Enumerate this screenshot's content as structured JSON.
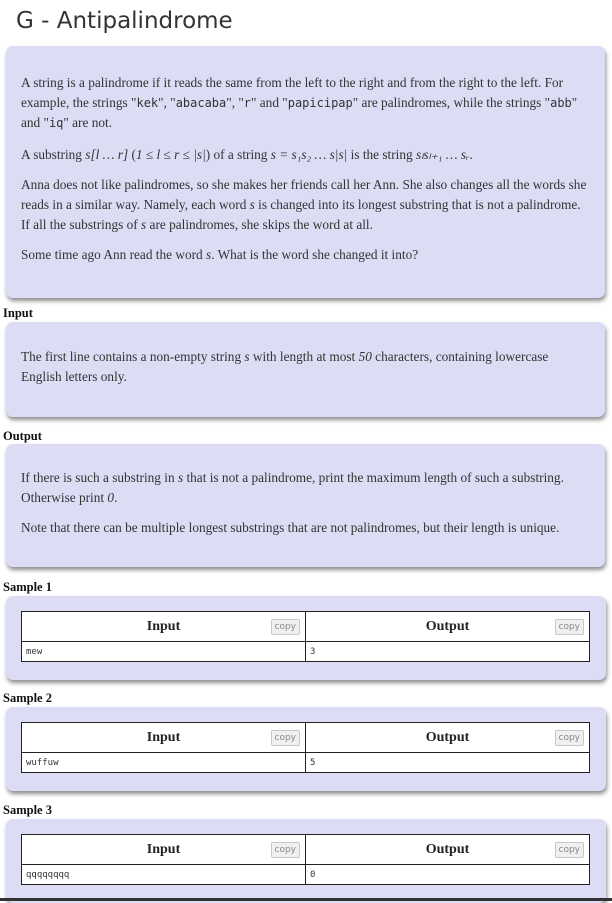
{
  "title": "G - Antipalindrome",
  "statement": {
    "p1_a": "A string is a palindrome if it reads the same from the left to the right and from the right to the left. For example, the strings \"",
    "ex1": "kek",
    "sep1": "\", \"",
    "ex2": "abacaba",
    "sep2": "\", \"",
    "ex3": "r",
    "sep3": "\" and \"",
    "ex4": "papicipap",
    "sep4": "\" are palindromes, while the strings \"",
    "ex5": "abb",
    "sep5": "\" and \"",
    "ex6": "iq",
    "p1_end": "\" are not.",
    "p2_a": "A substring ",
    "p2_m1": "s[l … r]",
    "p2_b": " (",
    "p2_m2": "1 ≤ l ≤ r ≤ |s|",
    "p2_c": ") of a string ",
    "p2_m3": "s = s₁s₂ … s|s|",
    "p2_d": " is the string ",
    "p2_m4": "sₗsₗ₊₁ … sᵣ",
    "p2_e": ".",
    "p3_a": "Anna does not like palindromes, so she makes her friends call her Ann. She also changes all the words she reads in a similar way. Namely, each word ",
    "p3_m1": "s",
    "p3_b": " is changed into its longest substring that is not a palindrome. If all the substrings of ",
    "p3_m2": "s",
    "p3_c": " are palindromes, she skips the word at all.",
    "p4_a": "Some time ago Ann read the word ",
    "p4_m": "s",
    "p4_b": ". What is the word she changed it into?"
  },
  "input_section": {
    "heading": "Input",
    "text_a": "The first line contains a non-empty string ",
    "text_m1": "s",
    "text_b": " with length at most ",
    "text_m2": "50",
    "text_c": " characters, containing lowercase English letters only."
  },
  "output_section": {
    "heading": "Output",
    "p1_a": "If there is such a substring in ",
    "p1_m1": "s",
    "p1_b": " that is not a palindrome, print the maximum length of such a substring. Otherwise print ",
    "p1_m2": "0",
    "p1_c": ".",
    "p2": "Note that there can be multiple longest substrings that are not palindromes, but their length is unique."
  },
  "samples": [
    {
      "heading": "Sample 1",
      "input_label": "Input",
      "output_label": "Output",
      "copy_label": "copy",
      "input": "mew",
      "output": "3"
    },
    {
      "heading": "Sample 2",
      "input_label": "Input",
      "output_label": "Output",
      "copy_label": "copy",
      "input": "wuffuw",
      "output": "5"
    },
    {
      "heading": "Sample 3",
      "input_label": "Input",
      "output_label": "Output",
      "copy_label": "copy",
      "input": "qqqqqqqq",
      "output": "0"
    }
  ]
}
